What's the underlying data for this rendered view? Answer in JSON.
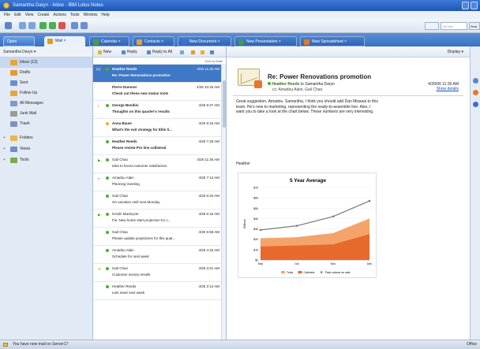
{
  "window": {
    "title": "Samantha Daryn - Inbox - IBM Lotus Notes"
  },
  "menu": [
    "File",
    "Edit",
    "View",
    "Create",
    "Actions",
    "Tools",
    "Window",
    "Help"
  ],
  "toolbar": {
    "search_placeholder": "All Mail",
    "search_button": "Sear"
  },
  "tabs": {
    "open": "Open",
    "items": [
      {
        "label": "Mail",
        "active": true,
        "color": "#e39b2a"
      },
      {
        "label": "Calendar",
        "color": "#4f9a3a"
      },
      {
        "label": "Contacts",
        "color": "#e0a43a"
      },
      {
        "label": "New Document",
        "color": "#3b6fd1"
      },
      {
        "label": "New Presentation",
        "color": "#3aa04a"
      },
      {
        "label": "New Spreadsheet",
        "color": "#e07a2a"
      }
    ]
  },
  "nav": {
    "owner": "Samantha Daryn",
    "items": [
      {
        "label": "Inbox (12)",
        "icon": "inbox-icon",
        "color": "#e7a53a",
        "selected": true
      },
      {
        "label": "Drafts",
        "icon": "drafts-icon",
        "color": "#e39b2a"
      },
      {
        "label": "Sent",
        "icon": "sent-icon",
        "color": "#6b8fcf"
      },
      {
        "label": "Follow Up",
        "icon": "flag-icon",
        "color": "#e7a53a"
      },
      {
        "label": "All Messages",
        "icon": "all-messages-icon",
        "color": "#7d9ac8"
      },
      {
        "label": "Junk Mail",
        "icon": "junk-icon",
        "color": "#9a9a9a"
      },
      {
        "label": "Trash",
        "icon": "trash-icon",
        "color": "#7b95bd"
      }
    ],
    "groups": [
      {
        "label": "Folders",
        "icon": "folder-icon",
        "color": "#e8b84a"
      },
      {
        "label": "Views",
        "icon": "views-icon",
        "color": "#6b8fcf"
      },
      {
        "label": "Tools",
        "icon": "tools-icon",
        "color": "#7ca94a"
      }
    ]
  },
  "list": {
    "toolbar": {
      "new": "New",
      "reply": "Reply",
      "reply_all": "Reply to All",
      "more": "More Actions"
    },
    "sort_label": "Sort by Date",
    "messages": [
      {
        "from": "Heather Reeds",
        "date": "4/26 11:30 AM",
        "subject": "Re: Power Renovations promotion",
        "count": "(1)",
        "selected": true
      },
      {
        "from": "Pierre Dumont",
        "date": "4/26 10:15 AM",
        "subject": "Check out these new status tools",
        "bold": true,
        "nodot": true
      },
      {
        "from": "George Bendini",
        "date": "4/26 9:47 AM",
        "subject": "Thoughts on this quarter's results",
        "bold": true,
        "flag": "!",
        "flagcolor": "#d33"
      },
      {
        "from": "Anna Bauer",
        "date": "4/26 9:15 AM",
        "subject": "What's the exit strategy for Elite li...",
        "bold": true,
        "dotcolor": "#e3b42a"
      },
      {
        "from": "Heather Reeds",
        "date": "4/26 7:28 AM",
        "subject": "Please review Pro line collateral",
        "bold": true
      },
      {
        "from": "Gail Chao",
        "date": "4/25 11:45 AM",
        "subject": "Idea to boost customer satisfaction",
        "flag": "▶",
        "flagcolor": "#3c9a2a"
      },
      {
        "from": "Amadou Alain",
        "date": "4/25 7:12 AM",
        "subject": "Planning meeting",
        "flag": "◐",
        "flagcolor": "#2a4fa8"
      },
      {
        "from": "Gail Chao",
        "date": "4/25 6:34 AM",
        "subject": "On vacation until next Monday"
      },
      {
        "from": "Kristin MacEyver",
        "date": "4/25 6:16 AM",
        "subject": "Fw: New home start projection for c...",
        "flag": "▶",
        "flagcolor": "#3c9a2a"
      },
      {
        "from": "Gail Chao",
        "date": "4/25 5:58 AM",
        "subject": "Please update projections for this quar..."
      },
      {
        "from": "Amadou Alain",
        "date": "4/25 4:15 AM",
        "subject": "Schedule for next week"
      },
      {
        "from": "Gail Chao",
        "date": "4/25 3:31 AM",
        "subject": "Customer survey results",
        "flag": "✉",
        "flagcolor": "#b08a2a"
      },
      {
        "from": "Heather Reeds",
        "date": "4/25 2:12 AM",
        "subject": "Lets meet next week"
      }
    ]
  },
  "reader": {
    "display_label": "Display",
    "subject": "Re: Power Renovations promotion",
    "from": "Heather Reeds",
    "to_text": "to Samantha Daryn",
    "cc": "cc: Amadou Alain, Gail Chao",
    "date": "4/26/06 11:30 AM",
    "show_details": "Show details",
    "body": "Great suggestion, Amadou.  Samantha, I think you should add Dan Misawa to this team.  He's new to marketing, representing the ready-to-assemble line. Also, I want you to take a look at the chart below.  These numbers are very interesting.",
    "signature": "Heather"
  },
  "chart_data": {
    "type": "area",
    "title": "5 Year Average",
    "ylabel": "Millions",
    "categories": [
      "Sep",
      "Oct",
      "Nov",
      "Dec"
    ],
    "y_ticks": [
      "$70",
      "$60",
      "$50",
      "$40",
      "$30",
      "$20",
      "$10",
      "$0"
    ],
    "ylim": [
      0,
      70
    ],
    "series": [
      {
        "name": "Tools",
        "type": "area",
        "color": "#f4a46a",
        "values": [
          21,
          22,
          26,
          40
        ]
      },
      {
        "name": "Cabinets",
        "type": "area",
        "color": "#e8692c",
        "values": [
          13,
          14,
          15,
          25
        ]
      },
      {
        "name": "Total volume on sale",
        "type": "line",
        "color": "#7a7a7a",
        "values": [
          29,
          33,
          42,
          57
        ]
      }
    ]
  },
  "status": {
    "message": "You have new mail on Server17",
    "location": "Office"
  }
}
